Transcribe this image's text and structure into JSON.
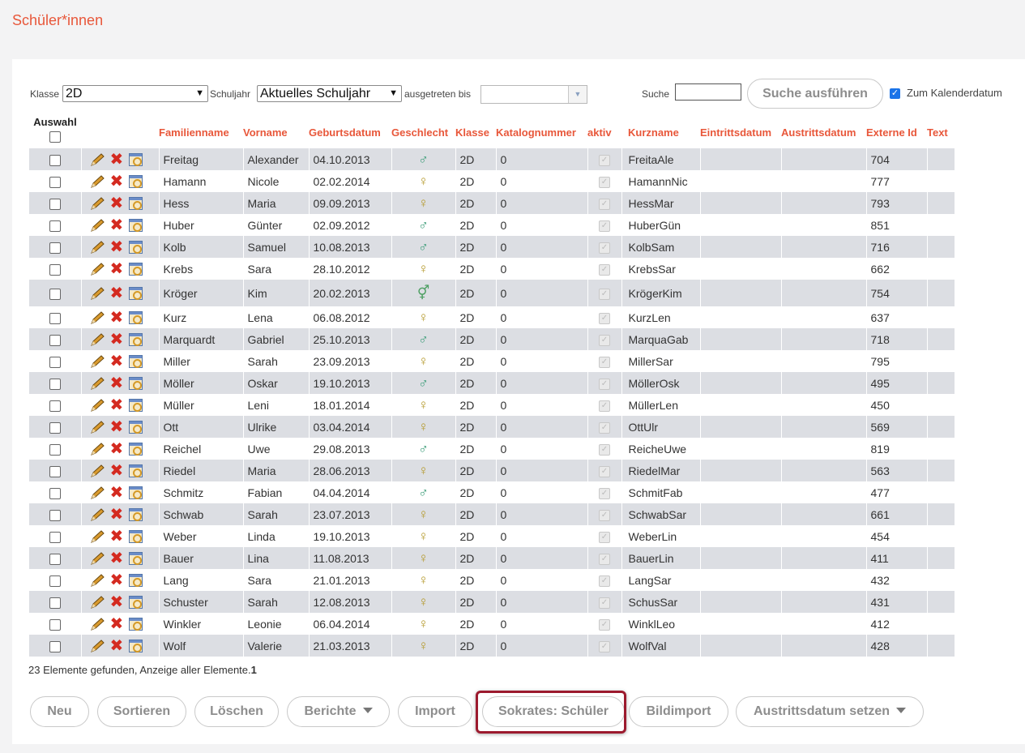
{
  "page_title": "Schüler*innen",
  "filters": {
    "klasse_label": "Klasse",
    "klasse_value": "2D",
    "schuljahr_label": "Schuljahr",
    "schuljahr_value": "Aktuelles Schuljahr",
    "ausgetreten_label": "ausgetreten bis",
    "ausgetreten_value": "",
    "suche_label": "Suche",
    "suche_value": "",
    "search_button": "Suche ausführen",
    "calendar_label": "Zum Kalenderdatum",
    "calendar_checked": true
  },
  "table": {
    "headers": {
      "auswahl": "Auswahl",
      "familienname": "Familienname",
      "vorname": "Vorname",
      "geburtsdatum": "Geburtsdatum",
      "geschlecht": "Geschlecht",
      "klasse": "Klasse",
      "katalognummer": "Katalognummer",
      "aktiv": "aktiv",
      "kurzname": "Kurzname",
      "eintrittsdatum": "Eintrittsdatum",
      "austrittsdatum": "Austrittsdatum",
      "externe_id": "Externe Id",
      "text": "Text"
    },
    "rows": [
      {
        "familienname": "Freitag",
        "vorname": "Alexander",
        "geburtsdatum": "04.10.2013",
        "geschlecht": "male",
        "klasse": "2D",
        "katalognummer": "0",
        "kurzname": "FreitaAle",
        "externe_id": "704"
      },
      {
        "familienname": "Hamann",
        "vorname": "Nicole",
        "geburtsdatum": "02.02.2014",
        "geschlecht": "female",
        "klasse": "2D",
        "katalognummer": "0",
        "kurzname": "HamannNic",
        "externe_id": "777"
      },
      {
        "familienname": "Hess",
        "vorname": "Maria",
        "geburtsdatum": "09.09.2013",
        "geschlecht": "female",
        "klasse": "2D",
        "katalognummer": "0",
        "kurzname": "HessMar",
        "externe_id": "793"
      },
      {
        "familienname": "Huber",
        "vorname": "Günter",
        "geburtsdatum": "02.09.2012",
        "geschlecht": "male",
        "klasse": "2D",
        "katalognummer": "0",
        "kurzname": "HuberGün",
        "externe_id": "851"
      },
      {
        "familienname": "Kolb",
        "vorname": "Samuel",
        "geburtsdatum": "10.08.2013",
        "geschlecht": "male",
        "klasse": "2D",
        "katalognummer": "0",
        "kurzname": "KolbSam",
        "externe_id": "716"
      },
      {
        "familienname": "Krebs",
        "vorname": "Sara",
        "geburtsdatum": "28.10.2012",
        "geschlecht": "female",
        "klasse": "2D",
        "katalognummer": "0",
        "kurzname": "KrebsSar",
        "externe_id": "662"
      },
      {
        "familienname": "Kröger",
        "vorname": "Kim",
        "geburtsdatum": "20.02.2013",
        "geschlecht": "diverse",
        "klasse": "2D",
        "katalognummer": "0",
        "kurzname": "KrögerKim",
        "externe_id": "754"
      },
      {
        "familienname": "Kurz",
        "vorname": "Lena",
        "geburtsdatum": "06.08.2012",
        "geschlecht": "female",
        "klasse": "2D",
        "katalognummer": "0",
        "kurzname": "KurzLen",
        "externe_id": "637"
      },
      {
        "familienname": "Marquardt",
        "vorname": "Gabriel",
        "geburtsdatum": "25.10.2013",
        "geschlecht": "male",
        "klasse": "2D",
        "katalognummer": "0",
        "kurzname": "MarquaGab",
        "externe_id": "718"
      },
      {
        "familienname": "Miller",
        "vorname": "Sarah",
        "geburtsdatum": "23.09.2013",
        "geschlecht": "female",
        "klasse": "2D",
        "katalognummer": "0",
        "kurzname": "MillerSar",
        "externe_id": "795"
      },
      {
        "familienname": "Möller",
        "vorname": "Oskar",
        "geburtsdatum": "19.10.2013",
        "geschlecht": "male",
        "klasse": "2D",
        "katalognummer": "0",
        "kurzname": "MöllerOsk",
        "externe_id": "495"
      },
      {
        "familienname": "Müller",
        "vorname": "Leni",
        "geburtsdatum": "18.01.2014",
        "geschlecht": "female",
        "klasse": "2D",
        "katalognummer": "0",
        "kurzname": "MüllerLen",
        "externe_id": "450"
      },
      {
        "familienname": "Ott",
        "vorname": "Ulrike",
        "geburtsdatum": "03.04.2014",
        "geschlecht": "female",
        "klasse": "2D",
        "katalognummer": "0",
        "kurzname": "OttUlr",
        "externe_id": "569"
      },
      {
        "familienname": "Reichel",
        "vorname": "Uwe",
        "geburtsdatum": "29.08.2013",
        "geschlecht": "male",
        "klasse": "2D",
        "katalognummer": "0",
        "kurzname": "ReicheUwe",
        "externe_id": "819"
      },
      {
        "familienname": "Riedel",
        "vorname": "Maria",
        "geburtsdatum": "28.06.2013",
        "geschlecht": "female",
        "klasse": "2D",
        "katalognummer": "0",
        "kurzname": "RiedelMar",
        "externe_id": "563"
      },
      {
        "familienname": "Schmitz",
        "vorname": "Fabian",
        "geburtsdatum": "04.04.2014",
        "geschlecht": "male",
        "klasse": "2D",
        "katalognummer": "0",
        "kurzname": "SchmitFab",
        "externe_id": "477"
      },
      {
        "familienname": "Schwab",
        "vorname": "Sarah",
        "geburtsdatum": "23.07.2013",
        "geschlecht": "female",
        "klasse": "2D",
        "katalognummer": "0",
        "kurzname": "SchwabSar",
        "externe_id": "661"
      },
      {
        "familienname": "Weber",
        "vorname": "Linda",
        "geburtsdatum": "19.10.2013",
        "geschlecht": "female",
        "klasse": "2D",
        "katalognummer": "0",
        "kurzname": "WeberLin",
        "externe_id": "454"
      },
      {
        "familienname": "Bauer",
        "vorname": "Lina",
        "geburtsdatum": "11.08.2013",
        "geschlecht": "female",
        "klasse": "2D",
        "katalognummer": "0",
        "kurzname": "BauerLin",
        "externe_id": "411"
      },
      {
        "familienname": "Lang",
        "vorname": "Sara",
        "geburtsdatum": "21.01.2013",
        "geschlecht": "female",
        "klasse": "2D",
        "katalognummer": "0",
        "kurzname": "LangSar",
        "externe_id": "432"
      },
      {
        "familienname": "Schuster",
        "vorname": "Sarah",
        "geburtsdatum": "12.08.2013",
        "geschlecht": "female",
        "klasse": "2D",
        "katalognummer": "0",
        "kurzname": "SchusSar",
        "externe_id": "431"
      },
      {
        "familienname": "Winkler",
        "vorname": "Leonie",
        "geburtsdatum": "06.04.2014",
        "geschlecht": "female",
        "klasse": "2D",
        "katalognummer": "0",
        "kurzname": "WinklLeo",
        "externe_id": "412"
      },
      {
        "familienname": "Wolf",
        "vorname": "Valerie",
        "geburtsdatum": "21.03.2013",
        "geschlecht": "female",
        "klasse": "2D",
        "katalognummer": "0",
        "kurzname": "WolfVal",
        "externe_id": "428"
      }
    ]
  },
  "footer": {
    "count_text": "23 Elemente gefunden, Anzeige aller Elemente.",
    "page_number": "1"
  },
  "buttons": {
    "neu": "Neu",
    "sortieren": "Sortieren",
    "loeschen": "Löschen",
    "berichte": "Berichte",
    "import": "Import",
    "sokrates": "Sokrates: Schüler",
    "bildimport": "Bildimport",
    "austrittsdatum": "Austrittsdatum setzen"
  },
  "colors": {
    "accent": "#e8573a",
    "highlight_border": "#9c1a2e",
    "row_alt": "#dcdee3"
  }
}
